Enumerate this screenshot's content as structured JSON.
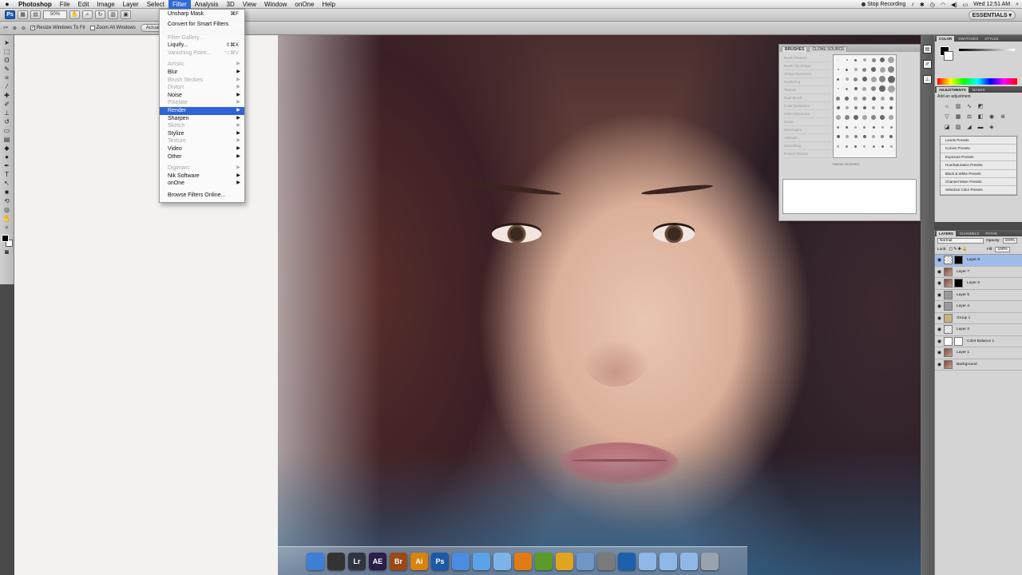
{
  "menubar": {
    "apple": "",
    "app_name": "Photoshop",
    "menus": [
      "File",
      "Edit",
      "Image",
      "Layer",
      "Select",
      "Filter",
      "Analysis",
      "3D",
      "View",
      "Window",
      "onOne",
      "Help"
    ],
    "active_menu": "Filter",
    "status": {
      "recording": "Stop Recording",
      "clock": "Wed 12:51 AM"
    }
  },
  "appbar": {
    "zoom": "50%",
    "workspace": "ESSENTIALS ▾"
  },
  "optionsbar": {
    "resize_windows": "Resize Windows To Fit",
    "zoom_all_windows": "Zoom All Windows",
    "actual_pixels": "Actual Pixels"
  },
  "filter_menu": {
    "items": [
      {
        "label": "Unsharp Mask",
        "shortcut": "⌘F",
        "disabled": false,
        "submenu": false
      },
      {
        "label": "Convert for Smart Filters",
        "shortcut": "",
        "disabled": false,
        "submenu": false
      },
      {
        "label": "Filter Gallery...",
        "shortcut": "",
        "disabled": true,
        "submenu": false
      },
      {
        "label": "Liquify...",
        "shortcut": "⇧⌘X",
        "disabled": false,
        "submenu": false
      },
      {
        "label": "Vanishing Point...",
        "shortcut": "⌥⌘V",
        "disabled": true,
        "submenu": false
      },
      {
        "label": "Artistic",
        "disabled": true,
        "submenu": true
      },
      {
        "label": "Blur",
        "disabled": false,
        "submenu": true
      },
      {
        "label": "Brush Strokes",
        "disabled": true,
        "submenu": true
      },
      {
        "label": "Distort",
        "disabled": true,
        "submenu": true
      },
      {
        "label": "Noise",
        "disabled": false,
        "submenu": true
      },
      {
        "label": "Pixelate",
        "disabled": true,
        "submenu": true
      },
      {
        "label": "Render",
        "disabled": false,
        "submenu": true,
        "highlighted": true
      },
      {
        "label": "Sharpen",
        "disabled": false,
        "submenu": true
      },
      {
        "label": "Sketch",
        "disabled": true,
        "submenu": true
      },
      {
        "label": "Stylize",
        "disabled": false,
        "submenu": true
      },
      {
        "label": "Texture",
        "disabled": true,
        "submenu": true
      },
      {
        "label": "Video",
        "disabled": false,
        "submenu": true
      },
      {
        "label": "Other",
        "disabled": false,
        "submenu": true
      },
      {
        "label": "Digimarc",
        "disabled": true,
        "submenu": true
      },
      {
        "label": "Nik Software",
        "disabled": false,
        "submenu": true
      },
      {
        "label": "onOne",
        "disabled": false,
        "submenu": true
      },
      {
        "label": "Browse Filters Online...",
        "disabled": false,
        "submenu": false
      }
    ]
  },
  "brushes_panel": {
    "tabs": [
      "BRUSHES",
      "CLONE SOURCE"
    ],
    "brush_presets": "Brush Presets",
    "brush_tip_shape": "Brush Tip Shape",
    "options": [
      "Shape Dynamics",
      "Scattering",
      "Texture",
      "Dual Brush",
      "Color Dynamics",
      "Other Dynamics",
      "Noise",
      "Wet Edges",
      "Airbrush",
      "Smoothing",
      "Protect Texture"
    ],
    "master_diameter": "Master Diameter"
  },
  "color_panel": {
    "tabs": [
      "COLOR",
      "SWATCHES",
      "STYLES"
    ]
  },
  "adjustments_panel": {
    "tabs": [
      "ADJUSTMENTS",
      "MASKS"
    ],
    "title": "Add an adjustment",
    "presets": [
      "Levels Presets",
      "Curves Presets",
      "Exposure Presets",
      "Hue/Saturation Presets",
      "Black & White Presets",
      "Channel Mixer Presets",
      "Selective Color Presets"
    ]
  },
  "layers_panel": {
    "tabs": [
      "LAYERS",
      "CHANNELS",
      "PATHS"
    ],
    "blend_mode": "Normal",
    "opacity_label": "Opacity:",
    "opacity": "100%",
    "fill_label": "Fill:",
    "fill": "100%",
    "lock_label": "Lock:",
    "layers": [
      {
        "name": "Layer 8",
        "selected": true,
        "thumb": "blank",
        "mask": "dark"
      },
      {
        "name": "Layer 7",
        "selected": false,
        "thumb": "photo"
      },
      {
        "name": "Layer 6",
        "selected": false,
        "thumb": "photo",
        "mask": "dark"
      },
      {
        "name": "Layer 5",
        "selected": false,
        "thumb": "gray"
      },
      {
        "name": "Layer 4",
        "selected": false,
        "thumb": "gray"
      },
      {
        "name": "Group 1",
        "selected": false,
        "thumb": "folder"
      },
      {
        "name": "Layer 2",
        "selected": false,
        "thumb": "blank"
      },
      {
        "name": "Color Balance 1",
        "selected": false,
        "thumb": "adjust",
        "mask": "white"
      },
      {
        "name": "Layer 1",
        "selected": false,
        "thumb": "photo"
      },
      {
        "name": "Background",
        "selected": false,
        "thumb": "photo"
      }
    ]
  },
  "dock": {
    "apps": [
      {
        "label": "",
        "name": "finder",
        "color": "#3e7fd6"
      },
      {
        "label": "",
        "name": "dashboard",
        "color": "#333333"
      },
      {
        "label": "Lr",
        "name": "lightroom",
        "color": "#2f3440"
      },
      {
        "label": "AE",
        "name": "after-effects",
        "color": "#2a1e4a"
      },
      {
        "label": "Br",
        "name": "bridge",
        "color": "#9a4a17"
      },
      {
        "label": "Ai",
        "name": "illustrator",
        "color": "#d9830f"
      },
      {
        "label": "Ps",
        "name": "photoshop",
        "color": "#1b5aa8"
      },
      {
        "label": "",
        "name": "safari",
        "color": "#4b8de0"
      },
      {
        "label": "",
        "name": "ichat",
        "color": "#5aa3e8"
      },
      {
        "label": "",
        "name": "itunes",
        "color": "#7cb3e8"
      },
      {
        "label": "",
        "name": "vlc",
        "color": "#e07b17"
      },
      {
        "label": "",
        "name": "transmission",
        "color": "#5a9a2a"
      },
      {
        "label": "",
        "name": "ftp",
        "color": "#e0a520"
      },
      {
        "label": "",
        "name": "preview",
        "color": "#6f95c9"
      },
      {
        "label": "",
        "name": "screenshot",
        "color": "#7a7a7a"
      },
      {
        "label": "",
        "name": "quicktime",
        "color": "#1e5fae"
      },
      {
        "label": "",
        "name": "folder-apps",
        "color": "#8fb8e6"
      },
      {
        "label": "",
        "name": "folder-docs",
        "color": "#8fb8e6"
      },
      {
        "label": "",
        "name": "folder-downloads",
        "color": "#8fb8e6"
      },
      {
        "label": "",
        "name": "trash",
        "color": "#9aa3ad"
      }
    ]
  }
}
